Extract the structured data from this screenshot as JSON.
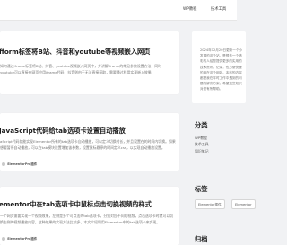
{
  "nav": {
    "items": [
      {
        "label": "WP教程"
      },
      {
        "label": "技术工具"
      }
    ]
  },
  "posts": [
    {
      "title": "fform标签将B站、抖音和youtube等视频嵌入网页",
      "excerpt": "如何通过iframe标签将B站、抖音、youtube视频嵌入网页中，并讲解iframe的常见参数设置方法，同时youtube可以直接在网页应用iframe代码，抖音则由于无法直接获取，需要通过利用实现嵌入效果。",
      "meta": ""
    },
    {
      "title": "JavaScript代码给tab选项卡设置自动播放",
      "excerpt": "aScript代码就能实现Elementor所有的tab选项卡自动播放，可以定义切换时长，并且设置在的时间内切换。如果想要暂停自动播放，可以在tab模块设置增加该参数，设置鼠标悬停的时间定义css，以实现自动播放设置。",
      "meta": "ElementorPro插件"
    },
    {
      "title": "ementor中在tab选项卡中鼠标点击切换视频的样式",
      "excerpt": "一个网页需要实现一个视频效果，左侧是多个可点击的tab选项卡，分别对应不同的视频，点击选项卡时就可以切换右侧的视频播放内容。这种效果的实现方法比较多，本文介绍利用Elementor中的tab选项卡来实现。",
      "meta": "ElementorPro插件"
    }
  ],
  "sidebar": {
    "notice": "2024年12月20日更新一个小发展的这个站，是想法一个精彩的人给您提供更多的实用的技术资讯，记录，也方便快速的用在这个网站。本站的内容都是我在平时工作中遇到的问题的解决方案，希望这些知识对您有所帮助。",
    "categories_heading": "分类",
    "categories": [
      {
        "label": "WP教程"
      },
      {
        "label": "技术工具"
      },
      {
        "label": "知识笔记"
      }
    ],
    "tags_heading": "标签",
    "tags": [
      {
        "label": "Elementor插件"
      },
      {
        "label": "Elementor"
      }
    ],
    "archive_heading": "归档"
  }
}
